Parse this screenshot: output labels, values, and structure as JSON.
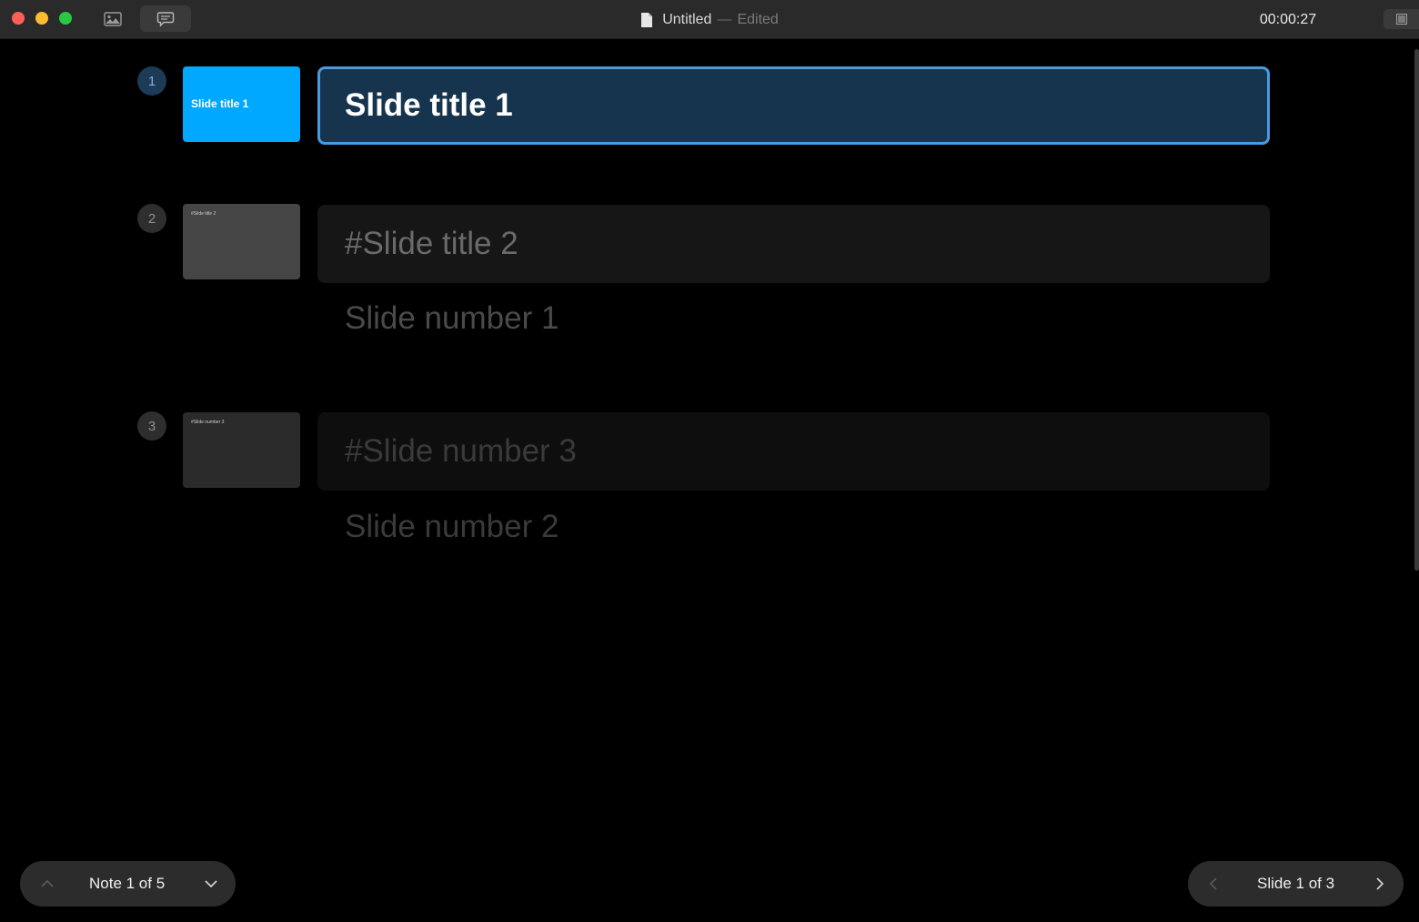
{
  "window": {
    "title": "Untitled",
    "separator": "—",
    "state": "Edited",
    "timer": "00:00:27"
  },
  "toolbar": {
    "image_icon": "image-icon",
    "comment_icon": "comment-icon",
    "grid_icon": "grid-icon"
  },
  "slides": [
    {
      "number": "1",
      "thumb_text": "Slide title 1",
      "title": "Slide title 1",
      "note": ""
    },
    {
      "number": "2",
      "thumb_text": "#Slide title 2",
      "title": "#Slide title 2",
      "note": "Slide number 1"
    },
    {
      "number": "3",
      "thumb_text": "#Slide number 3",
      "title": "#Slide number 3",
      "note": "Slide number 2"
    }
  ],
  "notes_nav": {
    "label": "Note 1 of 5",
    "prev_icon": "chevron-up-icon",
    "next_icon": "chevron-down-icon"
  },
  "slides_nav": {
    "label": "Slide 1 of 3",
    "prev_icon": "chevron-left-icon",
    "next_icon": "chevron-right-icon"
  },
  "colors": {
    "accent": "#4a9ae0",
    "active_field_bg": "#17344f",
    "slide1_thumb": "#00a8ff",
    "close": "#fe5f57",
    "minimize": "#febc2e",
    "maximize": "#28c840"
  }
}
